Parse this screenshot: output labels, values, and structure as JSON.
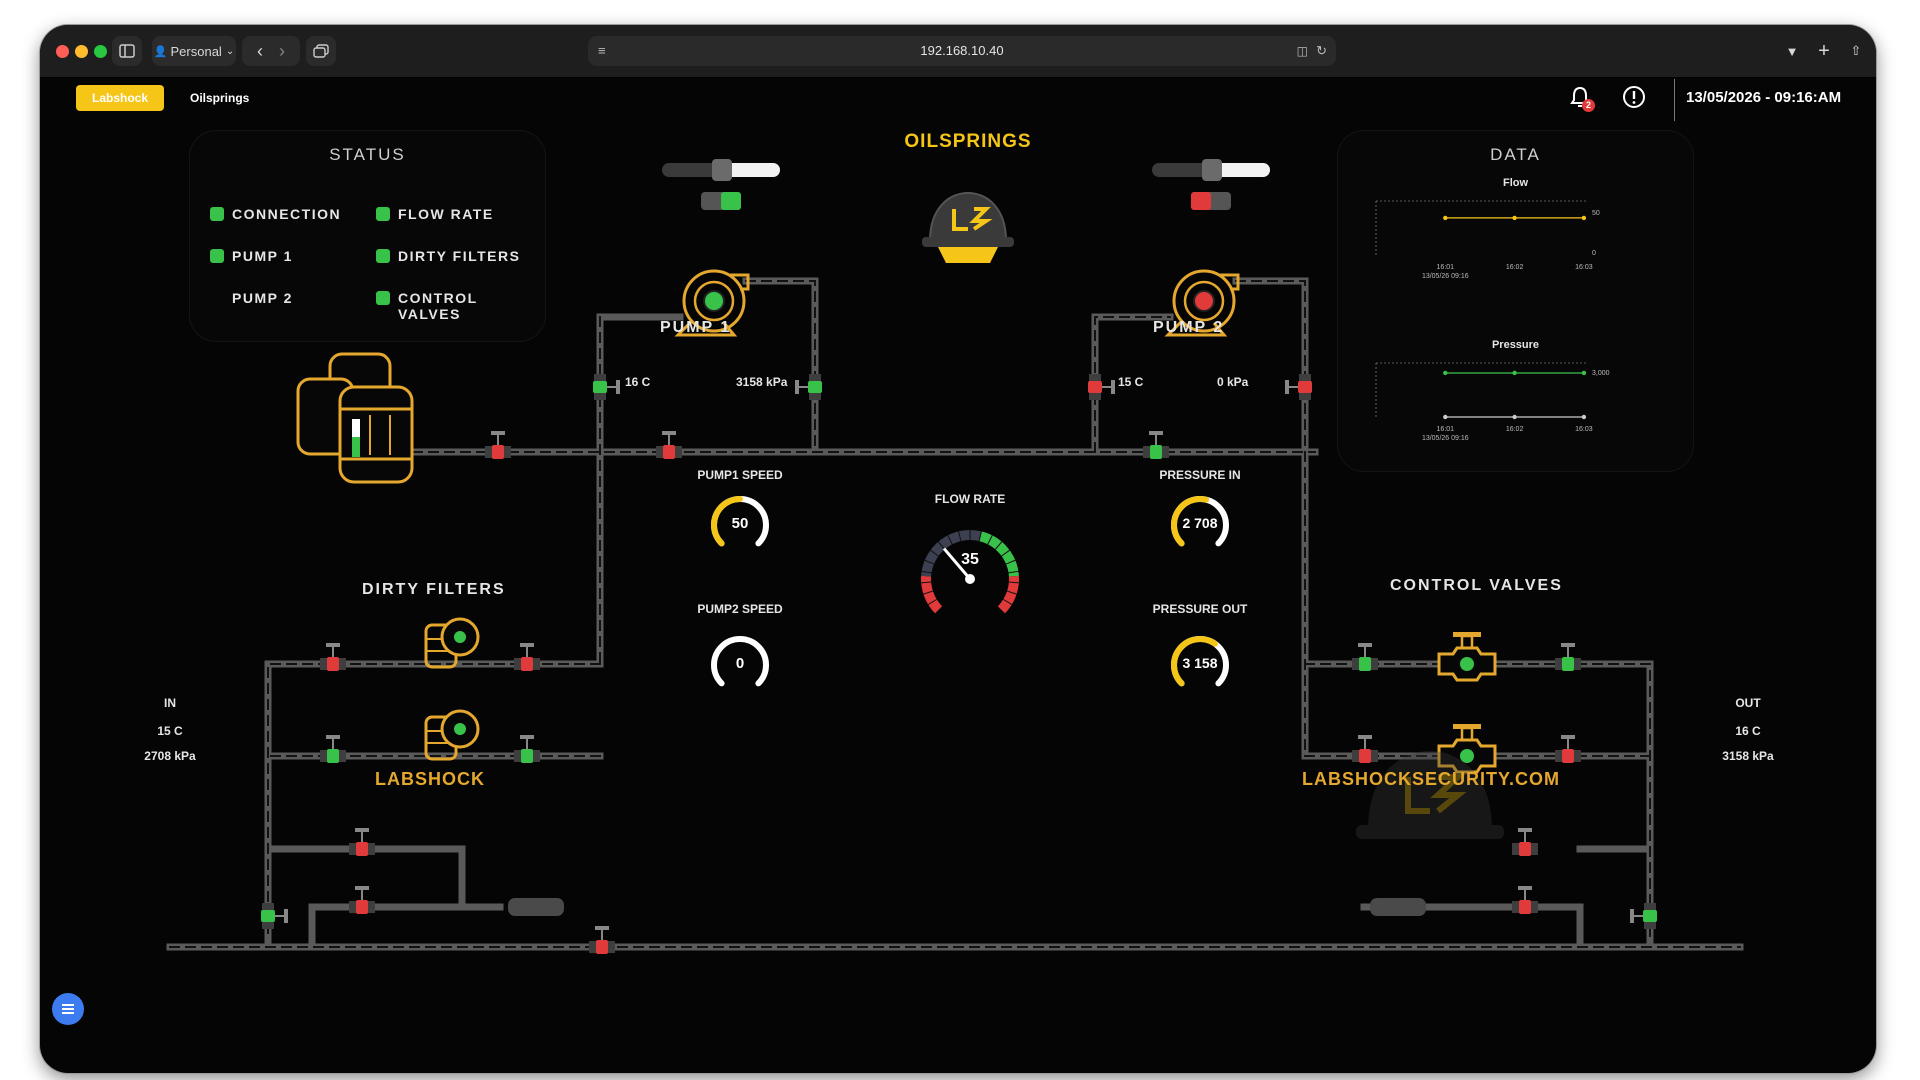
{
  "browser": {
    "profile": "Personal",
    "url": "192.168.10.40",
    "notification_count": "2"
  },
  "header": {
    "brand": "Labshock",
    "nav_item": "Oilsprings",
    "datetime": "13/05/2026 - 09:16:AM"
  },
  "status": {
    "title": "STATUS",
    "items": [
      {
        "label": "CONNECTION",
        "active": true
      },
      {
        "label": "FLOW RATE",
        "active": true
      },
      {
        "label": "PUMP 1",
        "active": true
      },
      {
        "label": "DIRTY FILTERS",
        "active": true
      },
      {
        "label": "PUMP 2",
        "active": false
      },
      {
        "label": "CONTROL VALVES",
        "active": true
      }
    ]
  },
  "plant": {
    "title": "OILSPRINGS",
    "pump1": {
      "label": "PUMP 1",
      "temp": "16 C",
      "pressure": "3158 kPa",
      "running": true
    },
    "pump2": {
      "label": "PUMP 2",
      "temp": "15 C",
      "pressure": "0 kPa",
      "running": false
    },
    "dirty_filters": "DIRTY FILTERS",
    "control_valves": "CONTROL VALVES",
    "inlet": {
      "label": "IN",
      "temp": "15 C",
      "pressure": "2708 kPa"
    },
    "outlet": {
      "label": "OUT",
      "temp": "16 C",
      "pressure": "3158 kPa"
    },
    "footer_left": "LABSHOCK",
    "footer_right": "LABSHOCKSECURITY.COM",
    "logo_text": "LS"
  },
  "gauges": {
    "pump1_speed": {
      "label": "PUMP1 SPEED",
      "value": "50",
      "fraction": 0.5
    },
    "pump2_speed": {
      "label": "PUMP2 SPEED",
      "value": "0",
      "fraction": 0.0
    },
    "pressure_in": {
      "label": "PRESSURE IN",
      "value": "2 708",
      "fraction": 0.55
    },
    "pressure_out": {
      "label": "PRESSURE OUT",
      "value": "3 158",
      "fraction": 0.63
    },
    "flow_rate": {
      "label": "FLOW RATE",
      "value": "35",
      "fraction": 0.35
    }
  },
  "data_panel": {
    "title": "DATA",
    "flow_chart": {
      "title": "Flow",
      "x_ticks": [
        "16:01",
        "16:02",
        "16:03"
      ],
      "x_first_sub": "13/05/26 09:16",
      "y_ticks": [
        "50",
        "0"
      ],
      "values": [
        50,
        50,
        50
      ]
    },
    "pressure_chart": {
      "title": "Pressure",
      "x_ticks": [
        "16:01",
        "16:02",
        "16:03"
      ],
      "x_first_sub": "13/05/26 09:16",
      "y_ticks": [
        "3,000"
      ],
      "series": [
        {
          "values": [
            3158,
            3158,
            3158
          ]
        },
        {
          "values": [
            0,
            0,
            0
          ]
        }
      ]
    }
  },
  "colors": {
    "accent": "#f5c518",
    "ok": "#39c24a",
    "alarm": "#e03a3a",
    "pipe": "#5a5a5a",
    "outline": "#e5a82e"
  }
}
